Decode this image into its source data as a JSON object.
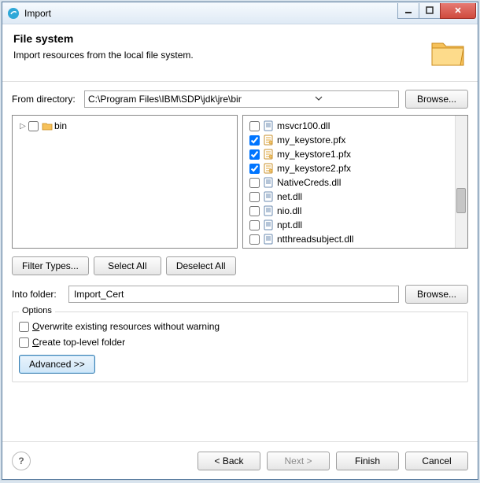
{
  "window": {
    "title": "Import"
  },
  "banner": {
    "heading": "File system",
    "subheading": "Import resources from the local file system."
  },
  "from_directory": {
    "label": "From directory:",
    "value": "C:\\Program Files\\IBM\\SDP\\jdk\\jre\\bin",
    "browse_label": "Browse..."
  },
  "tree": {
    "root": {
      "name": "bin",
      "checked": false
    }
  },
  "files": [
    {
      "name": "msvcr100.dll",
      "checked": false,
      "type": "dll"
    },
    {
      "name": "my_keystore.pfx",
      "checked": true,
      "type": "pfx"
    },
    {
      "name": "my_keystore1.pfx",
      "checked": true,
      "type": "pfx"
    },
    {
      "name": "my_keystore2.pfx",
      "checked": true,
      "type": "pfx"
    },
    {
      "name": "NativeCreds.dll",
      "checked": false,
      "type": "dll"
    },
    {
      "name": "net.dll",
      "checked": false,
      "type": "dll"
    },
    {
      "name": "nio.dll",
      "checked": false,
      "type": "dll"
    },
    {
      "name": "npt.dll",
      "checked": false,
      "type": "dll"
    },
    {
      "name": "ntthreadsubject.dll",
      "checked": false,
      "type": "dll"
    }
  ],
  "file_buttons": {
    "filter": "Filter Types...",
    "select_all": "Select All",
    "deselect_all": "Deselect All"
  },
  "into_folder": {
    "label": "Into folder:",
    "value": "Import_Cert",
    "browse_label": "Browse..."
  },
  "options": {
    "legend": "Options",
    "overwrite": {
      "label_pre": "O",
      "label_rest": "verwrite existing resources without warning",
      "checked": false
    },
    "top_level": {
      "label_pre": "C",
      "label_rest": "reate top-level folder",
      "checked": false
    },
    "advanced_label": "Advanced >>"
  },
  "footer": {
    "back": "< Back",
    "next": "Next >",
    "finish": "Finish",
    "cancel": "Cancel"
  }
}
